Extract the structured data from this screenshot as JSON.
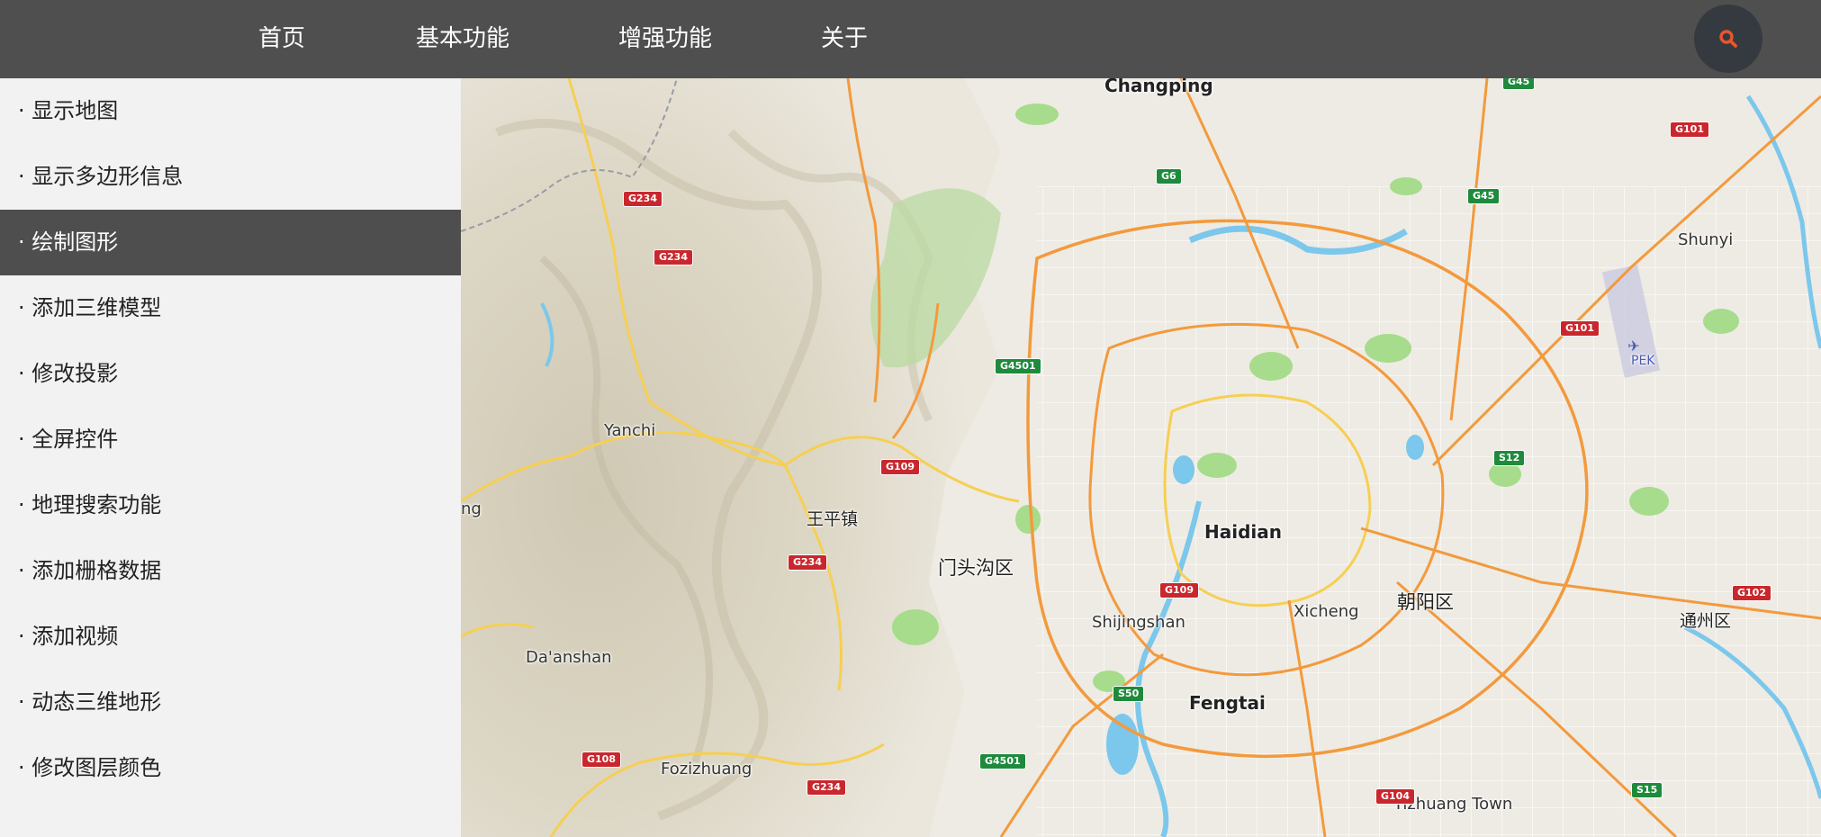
{
  "nav": {
    "items": [
      {
        "label": "首页"
      },
      {
        "label": "基本功能"
      },
      {
        "label": "增强功能"
      },
      {
        "label": "关于"
      }
    ],
    "search_icon": "search-icon"
  },
  "sidebar": {
    "active_index": 2,
    "items": [
      {
        "label": "· 显示地图"
      },
      {
        "label": "· 显示多边形信息"
      },
      {
        "label": "· 绘制图形"
      },
      {
        "label": "· 添加三维模型"
      },
      {
        "label": "· 修改投影"
      },
      {
        "label": "· 全屏控件"
      },
      {
        "label": "· 地理搜索功能"
      },
      {
        "label": "· 添加栅格数据"
      },
      {
        "label": "· 添加视频"
      },
      {
        "label": "· 动态三维地形"
      },
      {
        "label": "· 修改图层颜色"
      }
    ]
  },
  "map": {
    "places": {
      "changping": "Changping",
      "shunyi": "Shunyi",
      "pek": "PEK",
      "yanchi": "Yanchi",
      "wangpingzhen": "王平镇",
      "mentougouqu": "门头沟区",
      "haidian": "Haidian",
      "chaoyangqu": "朝阳区",
      "xicheng": "Xicheng",
      "shijingshan": "Shijingshan",
      "tongzhouqu": "通州区",
      "daanshan": "Da'anshan",
      "fengtai": "Fengtai",
      "fozizhuang": "Fozizhuang",
      "yizhuang": "Yizhuang Town",
      "edge_ng": "ng"
    },
    "shields": {
      "g45_top": "G45",
      "g101_a": "G101",
      "g234_a": "G234",
      "g6": "G6",
      "g45_b": "G45",
      "g234_b": "G234",
      "g101_b": "G101",
      "g4501_a": "G4501",
      "g109_a": "G109",
      "s12": "S12",
      "g234_c": "G234",
      "g109_b": "G109",
      "g102": "G102",
      "s50": "S50",
      "g4501_b": "G4501",
      "g108": "G108",
      "g234_d": "G234",
      "g104": "G104",
      "s15": "S15"
    },
    "colors": {
      "water": "#7cc7ec",
      "park": "#a6dc8b",
      "expressway": "#f39a3d",
      "road": "#f6cf53",
      "terrain": "#d9d3c2"
    }
  }
}
